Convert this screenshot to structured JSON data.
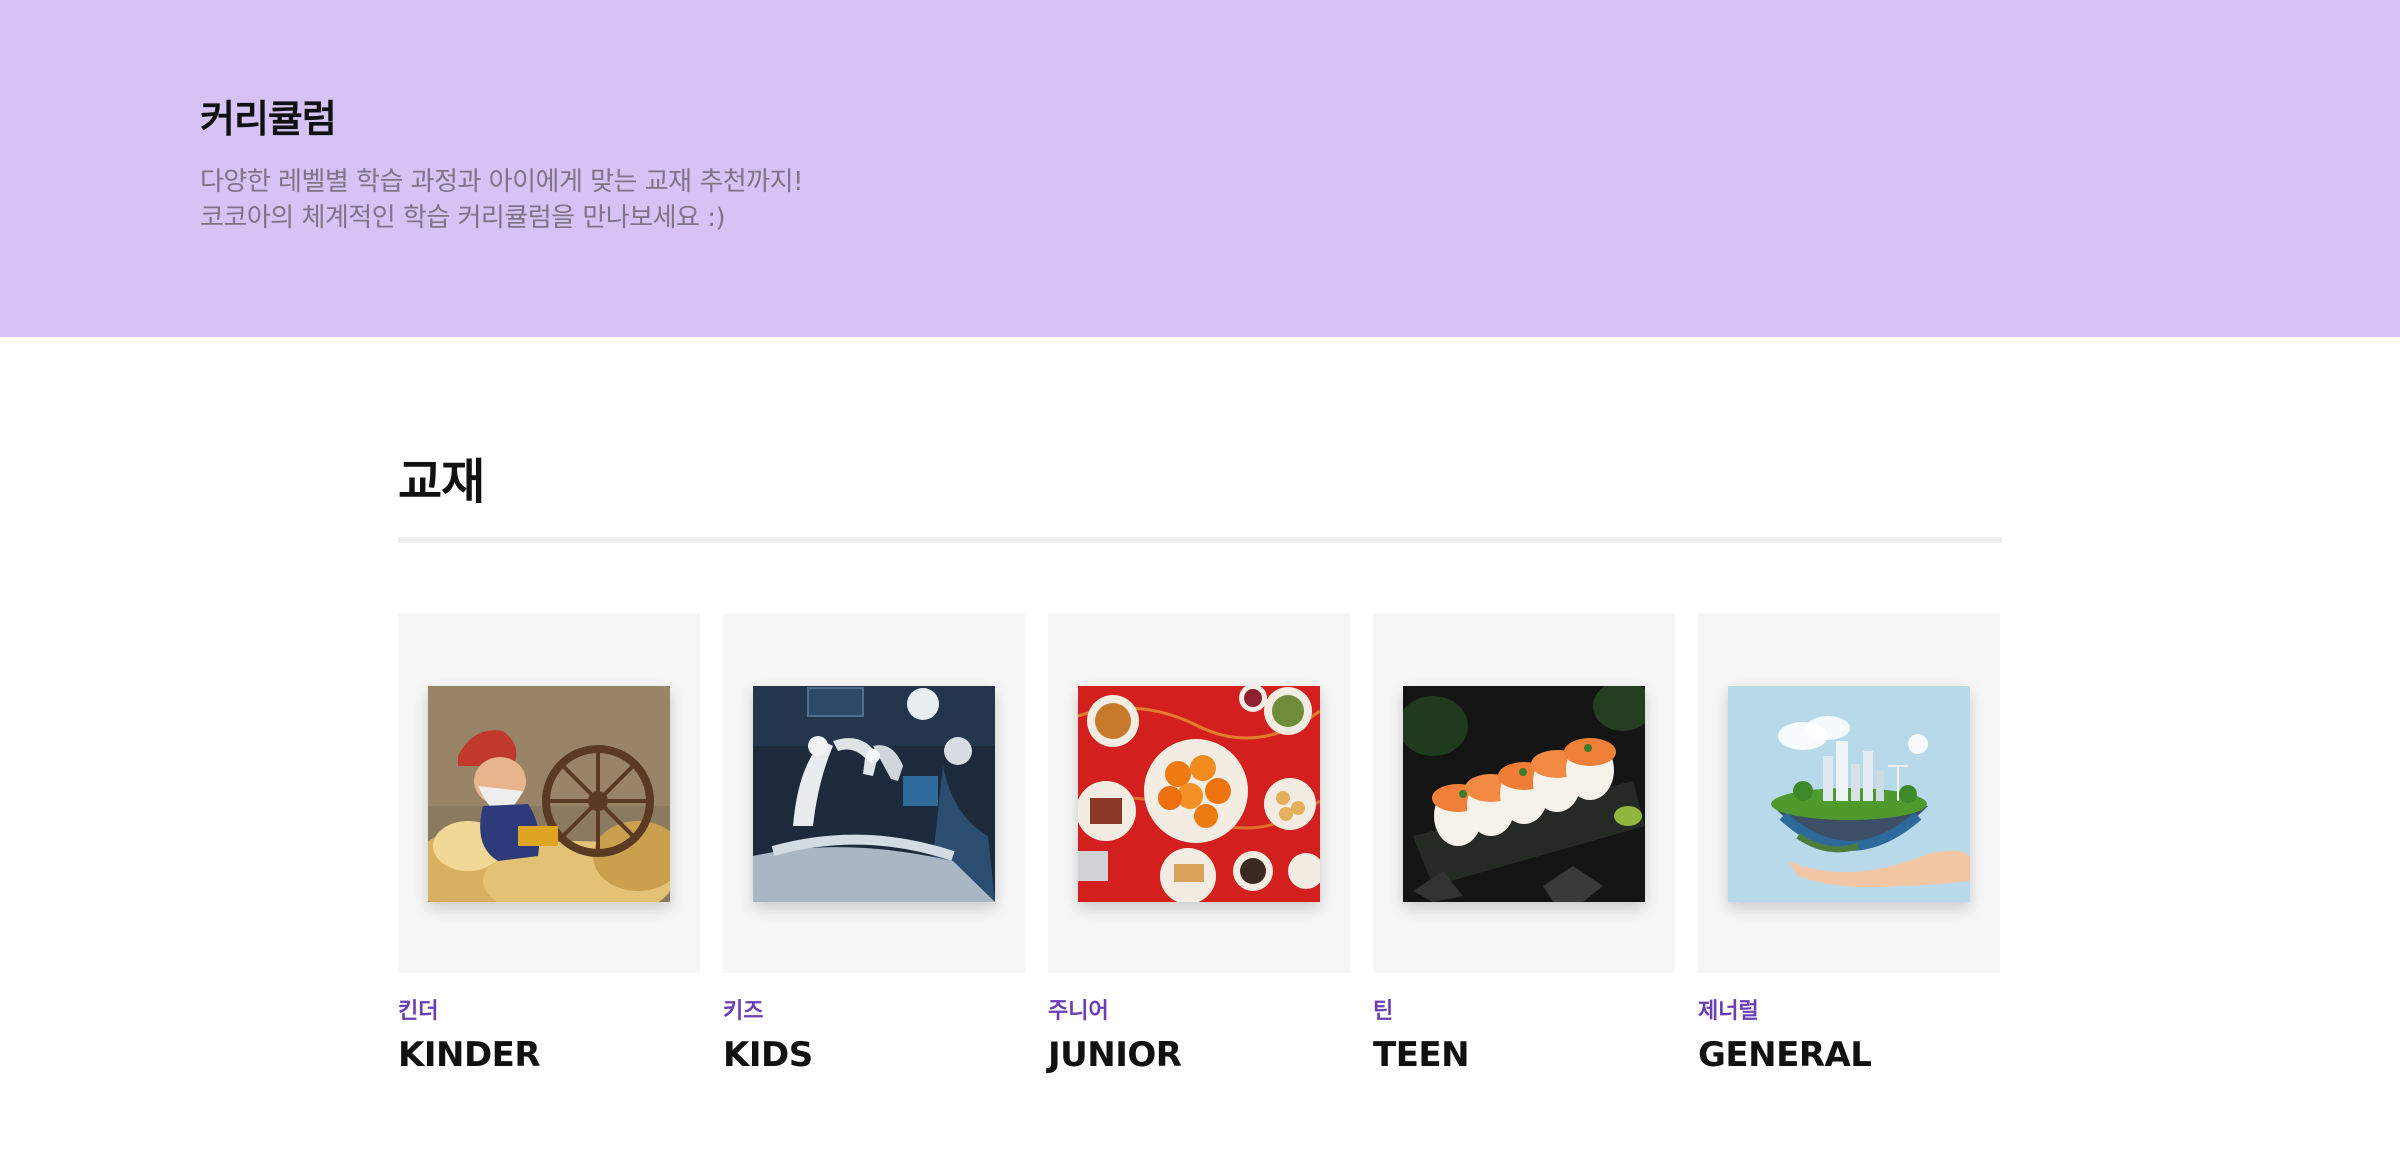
{
  "hero": {
    "title": "커리큘럼",
    "desc_line1": "다양한 레벨별 학습 과정과 아이에게 맞는 교재 추천까지!",
    "desc_line2": "코코아의 체계적인 학습 커리큘럼을 만나보세요 :)"
  },
  "section": {
    "title": "교재"
  },
  "colors": {
    "accent": "#d7c2f5",
    "level_label": "#6a3fb5"
  },
  "cards": [
    {
      "kr": "킨더",
      "en": "KINDER",
      "image": "fairy-tale-spinning-wheel-illustration"
    },
    {
      "kr": "키즈",
      "en": "KIDS",
      "image": "robotic-surgery-photo"
    },
    {
      "kr": "주니어",
      "en": "JUNIOR",
      "image": "lunar-new-year-feast-photo"
    },
    {
      "kr": "틴",
      "en": "TEEN",
      "image": "salmon-sushi-roll-photo"
    },
    {
      "kr": "제너럴",
      "en": "GENERAL",
      "image": "earth-in-hand-photo"
    }
  ]
}
